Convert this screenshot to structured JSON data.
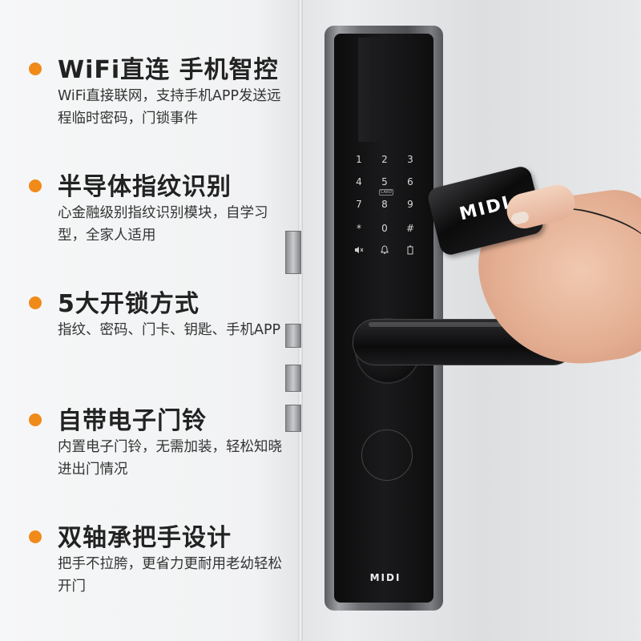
{
  "features": [
    {
      "title": "WiFi直连 手机智控",
      "desc": "WiFi直接联网，支持手机APP发送远程临时密码，门锁事件"
    },
    {
      "title": "半导体指纹识别",
      "desc": "心金融级别指纹识别模块，自学习型，全家人适用"
    },
    {
      "title": "5大开锁方式",
      "desc": "指纹、密码、门卡、钥匙、手机APP"
    },
    {
      "title": "自带电子门铃",
      "desc": "内置电子门铃，无需加装，轻松知晓进出门情况"
    },
    {
      "title": "双轴承把手设计",
      "desc": "把手不拉胯，更省力更耐用老幼轻松开门"
    }
  ],
  "keypad": {
    "keys": [
      "1",
      "2",
      "3",
      "4",
      "5",
      "6",
      "7",
      "8",
      "9",
      "*",
      "0",
      "#"
    ],
    "card_tag": "CARD",
    "icons": [
      "mute-icon",
      "bell-icon",
      "battery-icon"
    ]
  },
  "brand": "MIDI",
  "card_logo": "MIDI",
  "colors": {
    "bullet": "#f08a18",
    "lock_body": "#0c0c0d",
    "text": "#222222"
  }
}
